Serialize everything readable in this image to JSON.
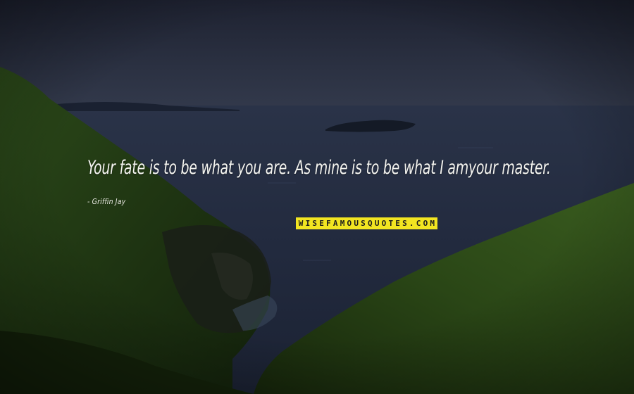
{
  "quote": {
    "text": "Your fate is to be what you are. As mine is to be what I amyour master.",
    "author": "- Griffin Jay"
  },
  "watermark": {
    "text": "WISEFAMOUSQUOTES.COM",
    "background": "#f2e521"
  },
  "colors": {
    "sky": "#262b3b",
    "sea": "#222b40",
    "grass": "#1f3a14",
    "quote_text": "#f4f4f0"
  }
}
